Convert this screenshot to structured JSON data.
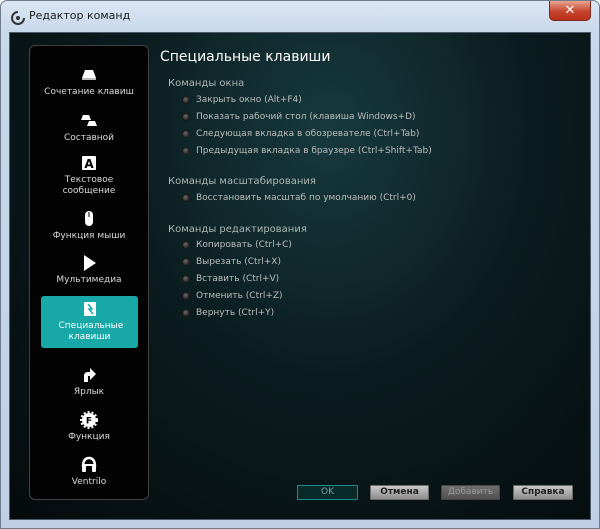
{
  "window": {
    "title": "Редактор команд",
    "close_symbol": "✕"
  },
  "sidebar": {
    "items": [
      {
        "label": "Сочетание клавиш",
        "icon": "keyboard-shortcut-icon"
      },
      {
        "label": "Составной",
        "icon": "multikey-icon"
      },
      {
        "label": "Текстовое сообщение",
        "icon": "text-block-icon",
        "glyph": "A"
      },
      {
        "label": "Функция мыши",
        "icon": "mouse-icon"
      },
      {
        "label": "Мультимедиа",
        "icon": "play-icon"
      },
      {
        "label": "Специальные клавиши",
        "icon": "hotkey-icon",
        "active": true
      },
      {
        "label": "Ярлык",
        "icon": "shortcut-arrow-icon"
      },
      {
        "label": "Функция",
        "icon": "function-gear-icon",
        "glyph": "F"
      },
      {
        "label": "Ventrilo",
        "icon": "headset-icon"
      }
    ]
  },
  "main": {
    "title": "Специальные клавиши",
    "groups": [
      {
        "title": "Команды окна",
        "options": [
          "Закрыть окно (Alt+F4)",
          "Показать рабочий стол (клавиша Windows+D)",
          "Следующая вкладка в обозревателе (Ctrl+Tab)",
          "Предыдущая вкладка в браузере (Ctrl+Shift+Tab)"
        ]
      },
      {
        "title": "Команды масштабирования",
        "options": [
          "Восстановить масштаб по умолчанию (Ctrl+0)"
        ]
      },
      {
        "title": "Команды редактирования",
        "options": [
          "Копировать (Ctrl+C)",
          "Вырезать (Ctrl+X)",
          "Вставить (Ctrl+V)",
          "Отменить (Ctrl+Z)",
          "Вернуть (Ctrl+Y)"
        ]
      }
    ]
  },
  "buttons": {
    "ok": "OK",
    "cancel": "Отмена",
    "add": "Добавить",
    "help": "Справка"
  },
  "colors": {
    "accent": "#19a8a8",
    "background": "#0b1c20"
  }
}
